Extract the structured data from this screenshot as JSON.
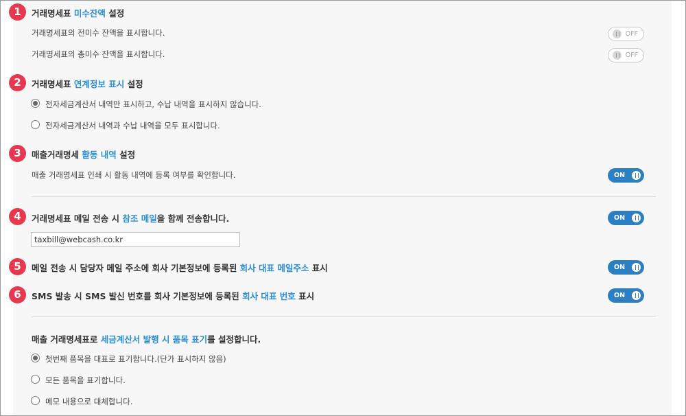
{
  "sections": {
    "s1": {
      "badge": "1",
      "title_pre": "거래명세표 ",
      "title_hl": "미수잔액",
      "title_post": " 설정",
      "rows": [
        {
          "text": "거래명세표의 전미수 잔액을 표시합니다.",
          "toggle": "OFF"
        },
        {
          "text": "거래명세표의 총미수 잔액을 표시합니다.",
          "toggle": "OFF"
        }
      ]
    },
    "s2": {
      "badge": "2",
      "title_pre": "거래명세표 ",
      "title_hl": "연계정보 표시",
      "title_post": " 설정",
      "options": [
        {
          "text": "전자세금계산서 내역만 표시하고, 수납 내역을 표시하지 않습니다.",
          "checked": true
        },
        {
          "text": "전자세금계산서 내역과 수납 내역을 모두 표시합니다.",
          "checked": false
        }
      ]
    },
    "s3": {
      "badge": "3",
      "title_pre": "매출거래명세 ",
      "title_hl": "활동 내역",
      "title_post": " 설정",
      "row": {
        "text": "매출 거래명세표 인쇄 시 활동 내역에 등록 여부를 확인합니다.",
        "toggle": "ON"
      }
    },
    "s4": {
      "badge": "4",
      "title_pre": "거래명세표 메일 전송 시 ",
      "title_hl": "참조 메일",
      "title_post": "을 함께 전송합니다.",
      "toggle": "ON",
      "email_value": "taxbill@webcash.co.kr"
    },
    "s5": {
      "badge": "5",
      "title_pre": "메일 전송 시 담당자 메일 주소에 회사 기본정보에 등록된 ",
      "title_hl": "회사 대표 메일주소",
      "title_post": " 표시",
      "toggle": "ON"
    },
    "s6": {
      "badge": "6",
      "title_pre": "SMS 발송 시 SMS 발신 번호를 회사 기본정보에 등록된 ",
      "title_hl": "회사 대표 번호",
      "title_post": " 표시",
      "toggle": "ON"
    },
    "s7": {
      "title_pre": "매출 거래명세표로 ",
      "title_hl": "세금계산서 발행 시 품목 표기",
      "title_post": "를 설정합니다.",
      "options": [
        {
          "text": "첫번째 품목을 대표로 표기합니다.(단가 표시하지 않음)",
          "checked": true
        },
        {
          "text": "모든 품목을 표기합니다.",
          "checked": false
        },
        {
          "text": "메모 내용으로 대체합니다.",
          "checked": false
        }
      ]
    }
  },
  "colors": {
    "accent": "#2b8ed6",
    "badge": "#e8384f",
    "toggle_on": "#2d7fc3"
  }
}
